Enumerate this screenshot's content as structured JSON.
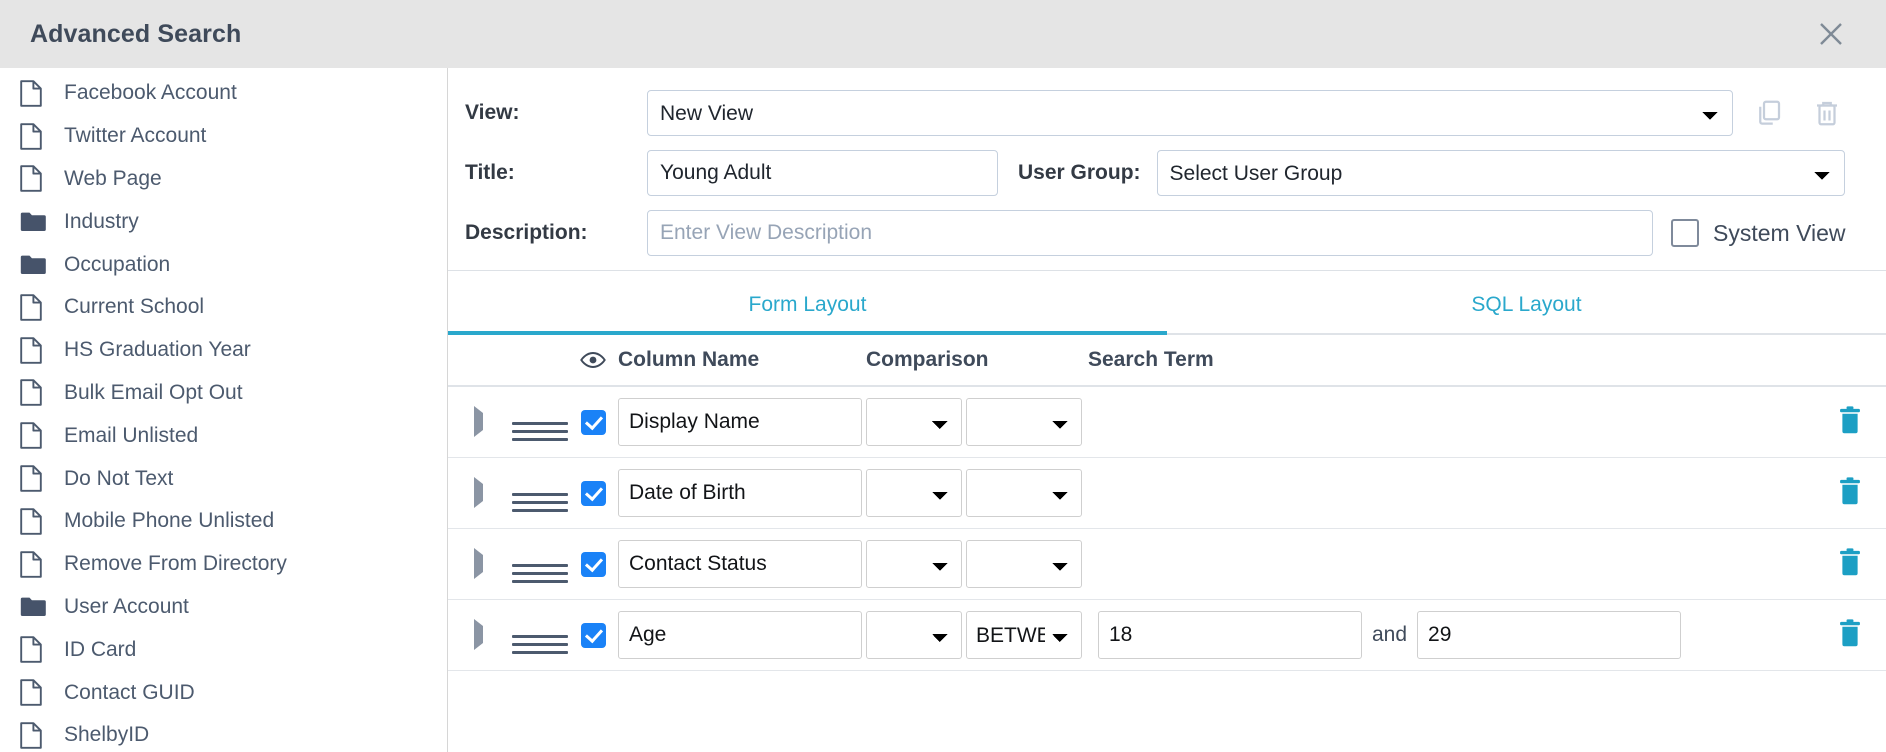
{
  "window": {
    "title": "Advanced Search",
    "close_icon": "close-icon"
  },
  "sidebar": {
    "items": [
      {
        "label": "Facebook Account",
        "icon": "file-icon"
      },
      {
        "label": "Twitter Account",
        "icon": "file-icon"
      },
      {
        "label": "Web Page",
        "icon": "file-icon"
      },
      {
        "label": "Industry",
        "icon": "folder-icon"
      },
      {
        "label": "Occupation",
        "icon": "folder-icon"
      },
      {
        "label": "Current School",
        "icon": "file-icon"
      },
      {
        "label": "HS Graduation Year",
        "icon": "file-icon"
      },
      {
        "label": "Bulk Email Opt Out",
        "icon": "file-icon"
      },
      {
        "label": "Email Unlisted",
        "icon": "file-icon"
      },
      {
        "label": "Do Not Text",
        "icon": "file-icon"
      },
      {
        "label": "Mobile Phone Unlisted",
        "icon": "file-icon"
      },
      {
        "label": "Remove From Directory",
        "icon": "file-icon"
      },
      {
        "label": "User Account",
        "icon": "folder-icon"
      },
      {
        "label": "ID Card",
        "icon": "file-icon"
      },
      {
        "label": "Contact GUID",
        "icon": "file-icon"
      },
      {
        "label": "ShelbyID",
        "icon": "file-icon"
      }
    ]
  },
  "form": {
    "view_label": "View:",
    "view_value": "New View",
    "copy_icon": "copy-icon",
    "delete_icon": "trash-icon",
    "title_label": "Title:",
    "title_value": "Young Adult",
    "user_group_label": "User Group:",
    "user_group_value": "Select User Group",
    "description_label": "Description:",
    "description_value": "",
    "description_placeholder": "Enter View Description",
    "system_view_label": "System View",
    "system_view_checked": false
  },
  "tabs": [
    {
      "label": "Form Layout",
      "active": true
    },
    {
      "label": "SQL Layout",
      "active": false
    }
  ],
  "table": {
    "headers": {
      "visibility_icon": "eye-icon",
      "column_name": "Column Name",
      "comparison": "Comparison",
      "search_term": "Search Term"
    },
    "and_label": "and",
    "rows": [
      {
        "expand_icon": "caret-right-icon",
        "drag_icon": "drag-handle-icon",
        "checked": true,
        "column_name": "Display Name",
        "operator1": "",
        "operator2": "",
        "term1": "",
        "term2": "",
        "show_term2": false,
        "delete_icon": "trash-icon"
      },
      {
        "expand_icon": "caret-right-icon",
        "drag_icon": "drag-handle-icon",
        "checked": true,
        "column_name": "Date of Birth",
        "operator1": "",
        "operator2": "",
        "term1": "",
        "term2": "",
        "show_term2": false,
        "delete_icon": "trash-icon"
      },
      {
        "expand_icon": "caret-right-icon",
        "drag_icon": "drag-handle-icon",
        "checked": true,
        "column_name": "Contact Status",
        "operator1": "",
        "operator2": "",
        "term1": "",
        "term2": "",
        "show_term2": false,
        "delete_icon": "trash-icon"
      },
      {
        "expand_icon": "caret-right-icon",
        "drag_icon": "drag-handle-icon",
        "checked": true,
        "column_name": "Age",
        "operator1": "",
        "operator2": "BETWEEN",
        "term1": "18",
        "term2": "29",
        "show_term2": true,
        "delete_icon": "trash-icon"
      }
    ]
  },
  "colors": {
    "accent": "#2aa8cc",
    "checkbox": "#1a82f7",
    "titlebar": "#e5e5e5",
    "text_dark": "#3f4a5a",
    "icon_muted": "#c5cedb"
  }
}
